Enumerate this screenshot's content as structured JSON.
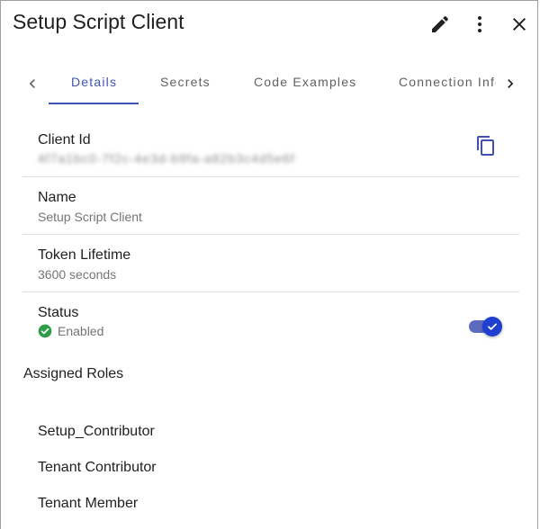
{
  "header": {
    "title": "Setup Script Client",
    "icons": {
      "edit": "edit-icon",
      "more": "more-vert-icon",
      "close": "close-icon"
    }
  },
  "tabs": {
    "items": [
      {
        "label": "Details",
        "active": true
      },
      {
        "label": "Secrets",
        "active": false
      },
      {
        "label": "Code Examples",
        "active": false
      },
      {
        "label": "Connection Info",
        "active": false
      }
    ],
    "prev_icon": "chevron-left-icon",
    "next_icon": "chevron-right-icon"
  },
  "details": {
    "client_id": {
      "label": "Client Id",
      "value": "4f7a1bc0-7f2c-4e3d-b9fa-a82b3c4d5e6f",
      "copy_icon": "copy-icon"
    },
    "name": {
      "label": "Name",
      "value": "Setup Script Client"
    },
    "token_lifetime": {
      "label": "Token Lifetime",
      "value": "3600 seconds"
    },
    "status": {
      "label": "Status",
      "value": "Enabled",
      "enabled": true,
      "status_icon": "check-circle-icon"
    }
  },
  "assigned_roles": {
    "title": "Assigned Roles",
    "items": [
      "Setup_Contributor",
      "Tenant Contributor",
      "Tenant Member"
    ]
  },
  "colors": {
    "accent": "#3f51b5",
    "toggle_thumb": "#1e3fcf",
    "success": "#2e9d4a",
    "divider": "#e0e0e0"
  }
}
